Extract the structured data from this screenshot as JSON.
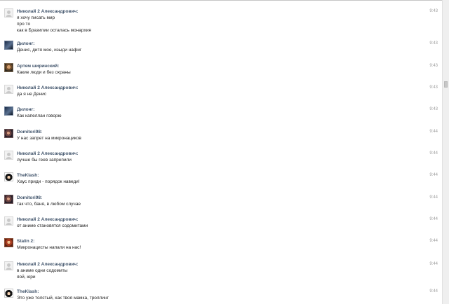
{
  "messages": [
    {
      "name": "Николай 2 Александрович:",
      "time": "9:43",
      "avatar": "default-avatar",
      "lines": [
        "я хочу писать мир",
        "про то",
        "как в Бразилии осталась монархия"
      ]
    },
    {
      "name": "Дилонг:",
      "time": "9:43",
      "avatar": "user-photo",
      "lines": [
        "Денис, дитя мое, изыди нафиг"
      ]
    },
    {
      "name": "Артем ширинский:",
      "time": "9:43",
      "avatar": "user-photo",
      "lines": [
        "Какие люди и без охраны"
      ]
    },
    {
      "name": "Николай 2 Александрович:",
      "time": "9:43",
      "avatar": "default-avatar",
      "lines": [
        "да я не Денис"
      ]
    },
    {
      "name": "Дилонг:",
      "time": "9:43",
      "avatar": "user-photo",
      "lines": [
        "Как капеллан говорю"
      ]
    },
    {
      "name": "Domitori98:",
      "time": "9:44",
      "avatar": "user-photo",
      "lines": [
        "У нас запрет на микронациков"
      ]
    },
    {
      "name": "Николай 2 Александрович:",
      "time": "9:44",
      "avatar": "default-avatar",
      "lines": [
        "лучше бы геев запрепили"
      ]
    },
    {
      "name": "TheKlash:",
      "time": "9:44",
      "avatar": "user-photo",
      "lines": [
        "Хаус приди - порядок наведи!"
      ]
    },
    {
      "name": "Domitori98:",
      "time": "9:44",
      "avatar": "user-photo",
      "lines": [
        "так что, баня, в любом случае"
      ]
    },
    {
      "name": "Николай 2 Александрович:",
      "time": "9:44",
      "avatar": "default-avatar",
      "lines": [
        "от аниме становятся содомитами"
      ]
    },
    {
      "name": "Stalin 2:",
      "time": "9:44",
      "avatar": "user-photo",
      "lines": [
        "Микронацисты напали на нас!"
      ]
    },
    {
      "name": "Николай 2 Александрович:",
      "time": "9:44",
      "avatar": "default-avatar",
      "lines": [
        "в аниме одни содомиты",
        "яой, юри"
      ]
    },
    {
      "name": "TheKlash:",
      "time": "9:44",
      "avatar": "user-photo",
      "lines": [
        "Это уже толстый, как твоя мамка, троллинг"
      ]
    }
  ]
}
